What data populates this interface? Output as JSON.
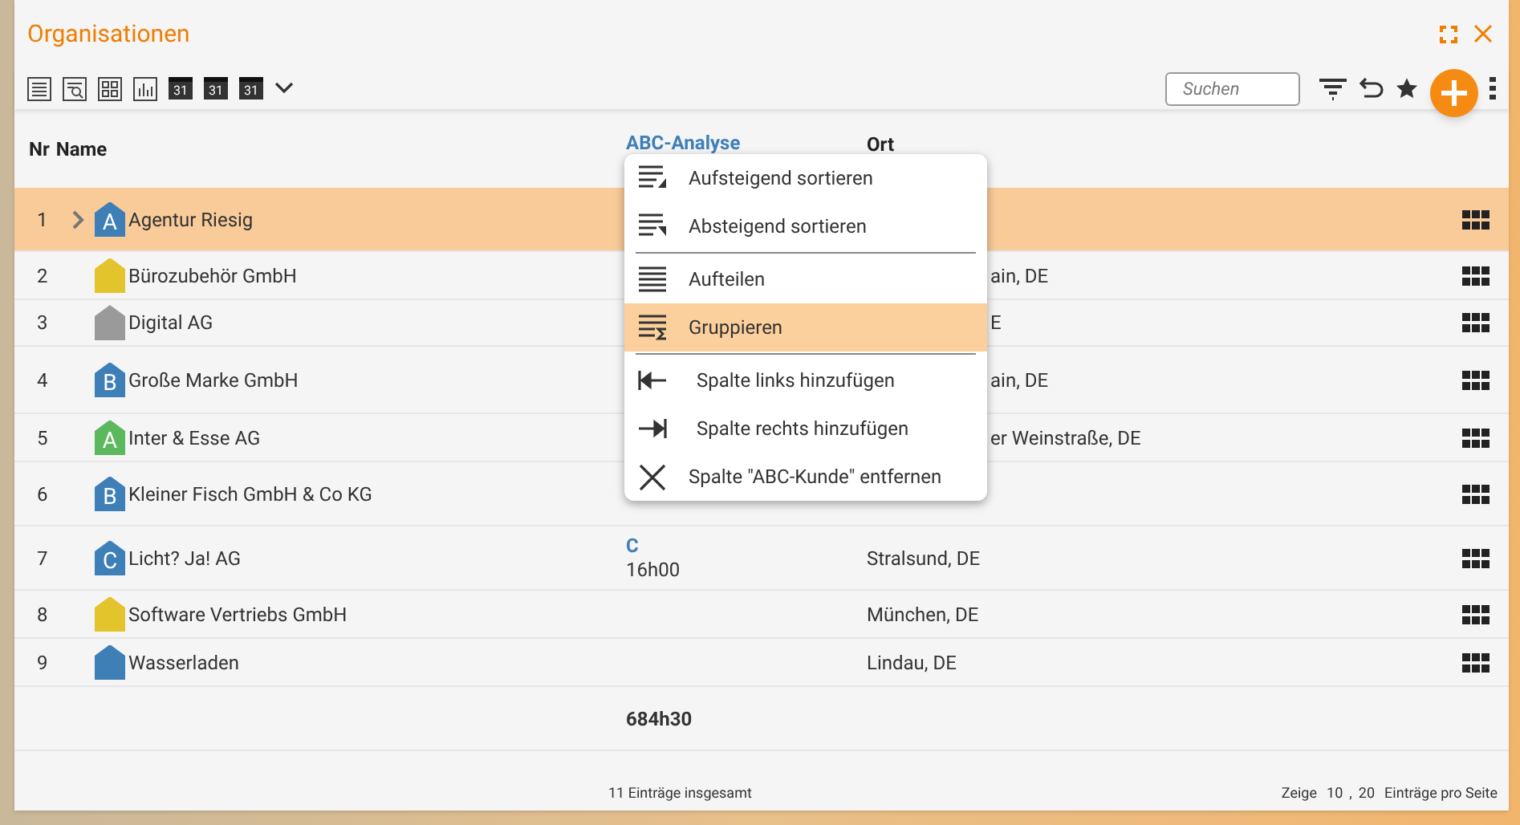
{
  "window": {
    "title": "Organisationen"
  },
  "toolbar": {
    "tools": [
      {
        "kind": "list"
      },
      {
        "kind": "search-list"
      },
      {
        "kind": "tiles"
      },
      {
        "kind": "chart"
      },
      {
        "kind": "calendar",
        "label": "31"
      },
      {
        "kind": "calendar",
        "label": "31"
      },
      {
        "kind": "calendar",
        "label": "31"
      },
      {
        "kind": "more"
      }
    ],
    "search": {
      "placeholder": "Suchen"
    }
  },
  "table": {
    "columns": [
      "Nr",
      "Name",
      "ABC-Analyse",
      "Ort"
    ],
    "rows": [
      {
        "nr": "1",
        "name": "Agentur Riesig",
        "badge": "A",
        "color": "#3f7fb8",
        "selected": true,
        "expandable": true,
        "abc": "",
        "hours": "",
        "ort": ""
      },
      {
        "nr": "2",
        "name": "Bürozubehör GmbH",
        "badge": "",
        "color": "#e3c42c",
        "selected": false,
        "expandable": false,
        "abc": "",
        "hours": "",
        "ort": "ain, DE"
      },
      {
        "nr": "3",
        "name": "Digital AG",
        "badge": "",
        "color": "#9a9a9a",
        "selected": false,
        "expandable": false,
        "abc": "",
        "hours": "",
        "ort": "E"
      },
      {
        "nr": "4",
        "name": "Große Marke GmbH",
        "badge": "B",
        "color": "#3f7fb8",
        "selected": false,
        "expandable": false,
        "abc": "",
        "hours": "",
        "ort": "ain, DE"
      },
      {
        "nr": "5",
        "name": "Inter & Esse AG",
        "badge": "A",
        "color": "#5cb85c",
        "selected": false,
        "expandable": false,
        "abc": "",
        "hours": "",
        "ort": "er Weinstraße, DE"
      },
      {
        "nr": "6",
        "name": "Kleiner Fisch GmbH & Co KG",
        "badge": "B",
        "color": "#3f7fb8",
        "selected": false,
        "expandable": false,
        "abc": "",
        "hours": "",
        "ort": ""
      },
      {
        "nr": "7",
        "name": "Licht? Ja! AG",
        "badge": "C",
        "color": "#3f7fb8",
        "selected": false,
        "expandable": false,
        "abc": "C",
        "hours": "16h00",
        "ort": "Stralsund, DE"
      },
      {
        "nr": "8",
        "name": "Software Vertriebs GmbH",
        "badge": "",
        "color": "#e3c42c",
        "selected": false,
        "expandable": false,
        "abc": "",
        "hours": "",
        "ort": "München, DE"
      },
      {
        "nr": "9",
        "name": "Wasserladen",
        "badge": "",
        "color": "#3f7fb8",
        "selected": false,
        "expandable": false,
        "abc": "",
        "hours": "",
        "ort": "Lindau, DE"
      }
    ],
    "total": "684h30"
  },
  "footer": {
    "count": "11 Einträge insgesamt",
    "show": "Zeige",
    "sizes": [
      "10",
      ",",
      "20"
    ],
    "per_page": "Einträge pro Seite"
  },
  "context_menu": {
    "items": [
      {
        "kind": "sort-asc",
        "label": "Aufsteigend sortieren",
        "selected": false,
        "divider_after": false
      },
      {
        "kind": "sort-desc",
        "label": "Absteigend sortieren",
        "selected": false,
        "divider_after": true
      },
      {
        "kind": "split",
        "label": "Aufteilen",
        "selected": false,
        "divider_after": false
      },
      {
        "kind": "group",
        "label": "Gruppieren",
        "selected": true,
        "divider_after": true
      },
      {
        "kind": "add-left",
        "label": "Spalte links hinzufügen",
        "selected": false,
        "divider_after": false
      },
      {
        "kind": "add-right",
        "label": "Spalte rechts hinzufügen",
        "selected": false,
        "divider_after": false
      },
      {
        "kind": "remove",
        "label": "Spalte \"ABC-Kunde\" entfernen",
        "selected": false,
        "divider_after": false
      }
    ]
  }
}
